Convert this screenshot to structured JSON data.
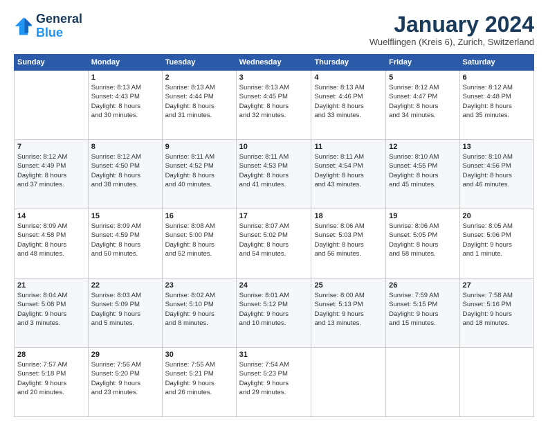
{
  "logo": {
    "line1": "General",
    "line2": "Blue"
  },
  "title": "January 2024",
  "subtitle": "Wuelflingen (Kreis 6), Zurich, Switzerland",
  "days_of_week": [
    "Sunday",
    "Monday",
    "Tuesday",
    "Wednesday",
    "Thursday",
    "Friday",
    "Saturday"
  ],
  "weeks": [
    [
      {
        "day": "",
        "info": ""
      },
      {
        "day": "1",
        "info": "Sunrise: 8:13 AM\nSunset: 4:43 PM\nDaylight: 8 hours\nand 30 minutes."
      },
      {
        "day": "2",
        "info": "Sunrise: 8:13 AM\nSunset: 4:44 PM\nDaylight: 8 hours\nand 31 minutes."
      },
      {
        "day": "3",
        "info": "Sunrise: 8:13 AM\nSunset: 4:45 PM\nDaylight: 8 hours\nand 32 minutes."
      },
      {
        "day": "4",
        "info": "Sunrise: 8:13 AM\nSunset: 4:46 PM\nDaylight: 8 hours\nand 33 minutes."
      },
      {
        "day": "5",
        "info": "Sunrise: 8:12 AM\nSunset: 4:47 PM\nDaylight: 8 hours\nand 34 minutes."
      },
      {
        "day": "6",
        "info": "Sunrise: 8:12 AM\nSunset: 4:48 PM\nDaylight: 8 hours\nand 35 minutes."
      }
    ],
    [
      {
        "day": "7",
        "info": "Sunrise: 8:12 AM\nSunset: 4:49 PM\nDaylight: 8 hours\nand 37 minutes."
      },
      {
        "day": "8",
        "info": "Sunrise: 8:12 AM\nSunset: 4:50 PM\nDaylight: 8 hours\nand 38 minutes."
      },
      {
        "day": "9",
        "info": "Sunrise: 8:11 AM\nSunset: 4:52 PM\nDaylight: 8 hours\nand 40 minutes."
      },
      {
        "day": "10",
        "info": "Sunrise: 8:11 AM\nSunset: 4:53 PM\nDaylight: 8 hours\nand 41 minutes."
      },
      {
        "day": "11",
        "info": "Sunrise: 8:11 AM\nSunset: 4:54 PM\nDaylight: 8 hours\nand 43 minutes."
      },
      {
        "day": "12",
        "info": "Sunrise: 8:10 AM\nSunset: 4:55 PM\nDaylight: 8 hours\nand 45 minutes."
      },
      {
        "day": "13",
        "info": "Sunrise: 8:10 AM\nSunset: 4:56 PM\nDaylight: 8 hours\nand 46 minutes."
      }
    ],
    [
      {
        "day": "14",
        "info": "Sunrise: 8:09 AM\nSunset: 4:58 PM\nDaylight: 8 hours\nand 48 minutes."
      },
      {
        "day": "15",
        "info": "Sunrise: 8:09 AM\nSunset: 4:59 PM\nDaylight: 8 hours\nand 50 minutes."
      },
      {
        "day": "16",
        "info": "Sunrise: 8:08 AM\nSunset: 5:00 PM\nDaylight: 8 hours\nand 52 minutes."
      },
      {
        "day": "17",
        "info": "Sunrise: 8:07 AM\nSunset: 5:02 PM\nDaylight: 8 hours\nand 54 minutes."
      },
      {
        "day": "18",
        "info": "Sunrise: 8:06 AM\nSunset: 5:03 PM\nDaylight: 8 hours\nand 56 minutes."
      },
      {
        "day": "19",
        "info": "Sunrise: 8:06 AM\nSunset: 5:05 PM\nDaylight: 8 hours\nand 58 minutes."
      },
      {
        "day": "20",
        "info": "Sunrise: 8:05 AM\nSunset: 5:06 PM\nDaylight: 9 hours\nand 1 minute."
      }
    ],
    [
      {
        "day": "21",
        "info": "Sunrise: 8:04 AM\nSunset: 5:08 PM\nDaylight: 9 hours\nand 3 minutes."
      },
      {
        "day": "22",
        "info": "Sunrise: 8:03 AM\nSunset: 5:09 PM\nDaylight: 9 hours\nand 5 minutes."
      },
      {
        "day": "23",
        "info": "Sunrise: 8:02 AM\nSunset: 5:10 PM\nDaylight: 9 hours\nand 8 minutes."
      },
      {
        "day": "24",
        "info": "Sunrise: 8:01 AM\nSunset: 5:12 PM\nDaylight: 9 hours\nand 10 minutes."
      },
      {
        "day": "25",
        "info": "Sunrise: 8:00 AM\nSunset: 5:13 PM\nDaylight: 9 hours\nand 13 minutes."
      },
      {
        "day": "26",
        "info": "Sunrise: 7:59 AM\nSunset: 5:15 PM\nDaylight: 9 hours\nand 15 minutes."
      },
      {
        "day": "27",
        "info": "Sunrise: 7:58 AM\nSunset: 5:16 PM\nDaylight: 9 hours\nand 18 minutes."
      }
    ],
    [
      {
        "day": "28",
        "info": "Sunrise: 7:57 AM\nSunset: 5:18 PM\nDaylight: 9 hours\nand 20 minutes."
      },
      {
        "day": "29",
        "info": "Sunrise: 7:56 AM\nSunset: 5:20 PM\nDaylight: 9 hours\nand 23 minutes."
      },
      {
        "day": "30",
        "info": "Sunrise: 7:55 AM\nSunset: 5:21 PM\nDaylight: 9 hours\nand 26 minutes."
      },
      {
        "day": "31",
        "info": "Sunrise: 7:54 AM\nSunset: 5:23 PM\nDaylight: 9 hours\nand 29 minutes."
      },
      {
        "day": "",
        "info": ""
      },
      {
        "day": "",
        "info": ""
      },
      {
        "day": "",
        "info": ""
      }
    ]
  ]
}
